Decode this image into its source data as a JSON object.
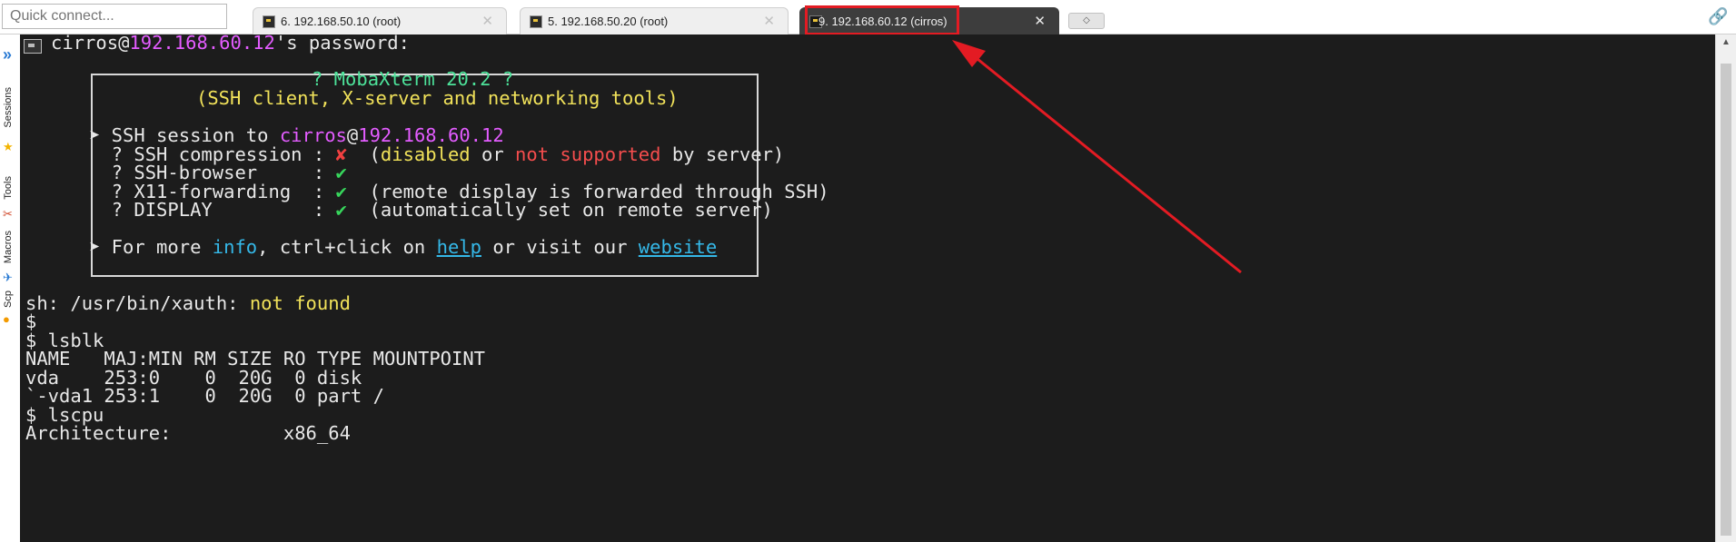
{
  "quick_connect": {
    "placeholder": "Quick connect..."
  },
  "tabs": [
    {
      "label": "6. 192.168.50.10 (root)",
      "close": "✕"
    },
    {
      "label": "5. 192.168.50.20 (root)",
      "close": "✕"
    },
    {
      "label": "9. 192.168.60.12 (cirros)",
      "close": "✕"
    }
  ],
  "sidebar": {
    "expand_icon": "double-chevron-right-icon",
    "items": [
      {
        "label": "Sessions",
        "icon": "star-icon"
      },
      {
        "label": "Tools",
        "icon": "tools-icon"
      },
      {
        "label": "Macros",
        "icon": "paper-plane-icon"
      },
      {
        "label": "Scp",
        "icon": "scp-icon"
      }
    ]
  },
  "terminal": {
    "prompt_user": "cirros",
    "prompt_at": "@",
    "prompt_host": "192.168.60.12",
    "prompt_tail": "'s password:",
    "banner": {
      "title": "? MobaXterm 20.2 ?",
      "subtitle": "(SSH client, X-server and networking tools)",
      "session_prefix": "➤ SSH session to ",
      "session_user": "cirros",
      "session_at": "@",
      "session_host": "192.168.60.12",
      "rows": [
        {
          "label": "  ? SSH compression : ",
          "mark": "✘",
          "mark_ok": false,
          "pre": "  (",
          "p1": "disabled",
          "p1_color": "y",
          "mid": " or ",
          "p2": "not supported",
          "p2_color": "r",
          "post": " by server)"
        },
        {
          "label": "  ? SSH-browser     : ",
          "mark": "✔",
          "mark_ok": true,
          "pre": "",
          "p1": "",
          "p1_color": "",
          "mid": "",
          "p2": "",
          "p2_color": "",
          "post": ""
        },
        {
          "label": "  ? X11-forwarding  : ",
          "mark": "✔",
          "mark_ok": true,
          "pre": "  (remote display is forwarded through SSH)",
          "p1": "",
          "p1_color": "",
          "mid": "",
          "p2": "",
          "p2_color": "",
          "post": ""
        },
        {
          "label": "  ? DISPLAY         : ",
          "mark": "✔",
          "mark_ok": true,
          "pre": "  (automatically set on remote server)",
          "p1": "",
          "p1_color": "",
          "mid": "",
          "p2": "",
          "p2_color": "",
          "post": ""
        }
      ],
      "more_prefix": "➤ For more ",
      "more_info": "info",
      "more_mid": ", ctrl+click on ",
      "more_help": "help",
      "more_or": " or visit our ",
      "more_website": "website"
    },
    "xauth_prefix": "sh: /usr/bin/xauth: ",
    "xauth_status": "not found",
    "lines_after": [
      "$",
      "$ lsblk",
      "NAME   MAJ:MIN RM SIZE RO TYPE MOUNTPOINT",
      "vda    253:0    0  20G  0 disk",
      "`-vda1 253:1    0  20G  0 part /",
      "$ lscpu",
      "Architecture:          x86_64"
    ]
  },
  "colors": {
    "highlight": "#e31b23",
    "terminal_bg": "#1c1c1c",
    "host": "#e35cff",
    "yellow": "#f1e25a",
    "red": "#f54d4d",
    "green_title": "#4de39a",
    "link": "#35b8e8"
  }
}
